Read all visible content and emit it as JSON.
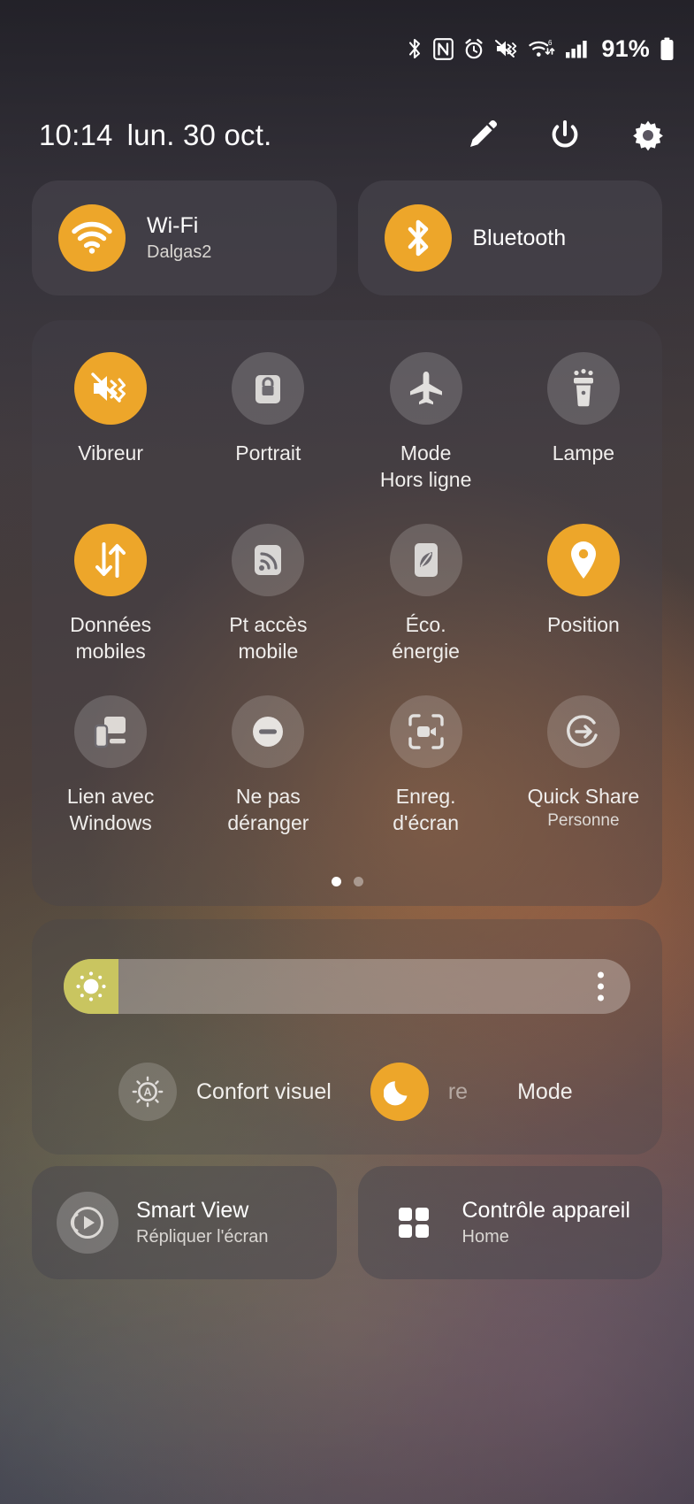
{
  "status_bar": {
    "icons": [
      "bluetooth-icon",
      "nfc-icon",
      "alarm-icon",
      "vibrate-icon",
      "wifi-6-icon",
      "signal-bars-icon"
    ],
    "battery_percent": "91%"
  },
  "header": {
    "time": "10:14",
    "date": "lun. 30 oct.",
    "actions": [
      {
        "name": "edit-button",
        "icon": "pencil-icon"
      },
      {
        "name": "power-button",
        "icon": "power-icon"
      },
      {
        "name": "settings-button",
        "icon": "gear-icon"
      }
    ]
  },
  "colors": {
    "accent_on": "#eda62a",
    "tile_off": "rgba(255,255,255,0.17)",
    "slider_fill": "#ccc85f"
  },
  "top_tiles": [
    {
      "label": "Wi-Fi",
      "sublabel": "Dalgas2",
      "icon": "wifi-icon",
      "active": true
    },
    {
      "label": "Bluetooth",
      "sublabel": "",
      "icon": "bluetooth-icon",
      "active": true
    }
  ],
  "quick_tiles": [
    {
      "label": "Vibreur",
      "icon": "vibrate-icon",
      "active": true,
      "sublabel": ""
    },
    {
      "label": "Portrait",
      "icon": "rotation-lock-icon",
      "active": false,
      "sublabel": ""
    },
    {
      "label": "Mode\nHors ligne",
      "icon": "airplane-icon",
      "active": false,
      "sublabel": ""
    },
    {
      "label": "Lampe",
      "icon": "flashlight-icon",
      "active": false,
      "sublabel": ""
    },
    {
      "label": "Données\nmobiles",
      "icon": "mobile-data-icon",
      "active": true,
      "sublabel": ""
    },
    {
      "label": "Pt accès\nmobile",
      "icon": "hotspot-icon",
      "active": false,
      "sublabel": ""
    },
    {
      "label": "Éco.\nénergie",
      "icon": "battery-saver-icon",
      "active": false,
      "sublabel": ""
    },
    {
      "label": "Position",
      "icon": "location-pin-icon",
      "active": true,
      "sublabel": ""
    },
    {
      "label": "Lien avec\nWindows",
      "icon": "link-to-windows-icon",
      "active": false,
      "sublabel": ""
    },
    {
      "label": "Ne pas\ndéranger",
      "icon": "do-not-disturb-icon",
      "active": false,
      "sublabel": ""
    },
    {
      "label": "Enreg.\nd'écran",
      "icon": "screen-record-icon",
      "active": false,
      "sublabel": ""
    },
    {
      "label": "Quick Share",
      "icon": "quick-share-icon",
      "active": false,
      "sublabel": "Personne"
    }
  ],
  "pager": {
    "pages": 2,
    "current": 1
  },
  "brightness": {
    "value_percent": 8,
    "knob_icon": "brightness-sun-icon",
    "menu_icon": "overflow-menu-icon"
  },
  "brightness_toggles": [
    {
      "label": "Confort visuel",
      "icon": "eye-comfort-icon",
      "active": false
    },
    {
      "label": "re",
      "icon": "dark-mode-moon-icon",
      "active": true
    },
    {
      "label": "Mode",
      "icon": "",
      "active": false
    }
  ],
  "bottom_tiles": [
    {
      "label": "Smart View",
      "sublabel": "Répliquer l'écran",
      "icon": "smart-view-icon",
      "active": false
    },
    {
      "label": "Contrôle appareil",
      "sublabel": "Home",
      "icon": "device-control-icon",
      "active": false
    }
  ]
}
